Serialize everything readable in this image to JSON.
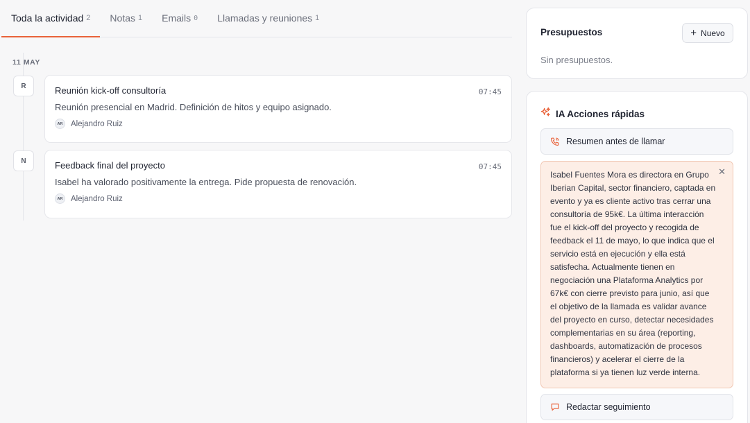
{
  "tabs": [
    {
      "label": "Toda la actividad",
      "count": "2"
    },
    {
      "label": "Notas",
      "count": "1"
    },
    {
      "label": "Emails",
      "count": "0"
    },
    {
      "label": "Llamadas y reuniones",
      "count": "1"
    }
  ],
  "timeline": {
    "date_label": "11 MAY",
    "items": [
      {
        "marker": "R",
        "title": "Reunión kick-off consultoría",
        "time": "07:45",
        "body": "Reunión presencial en Madrid. Definición de hitos y equipo asignado.",
        "author_initials": "AR",
        "author": "Alejandro Ruiz"
      },
      {
        "marker": "N",
        "title": "Feedback final del proyecto",
        "time": "07:45",
        "body": "Isabel ha valorado positivamente la entrega. Pide propuesta de renovación.",
        "author_initials": "AR",
        "author": "Alejandro Ruiz"
      }
    ]
  },
  "budgets": {
    "title": "Presupuestos",
    "new_label": "Nuevo",
    "empty_text": "Sin presupuestos."
  },
  "ai": {
    "title": "IA Acciones rápidas",
    "pre_call_label": "Resumen antes de llamar",
    "summary": "Isabel Fuentes Mora es directora en Grupo Iberian Capital, sector financiero, captada en evento y ya es cliente activo tras cerrar una consultoría de 95k€. La última interacción fue el kick-off del proyecto y recogida de feedback el 11 de mayo, lo que indica que el servicio está en ejecución y ella está satisfecha. Actualmente tienen en negociación una Plataforma Analytics por 67k€ con cierre previsto para junio, así que el objetivo de la llamada es validar avance del proyecto en curso, detectar necesidades complementarias en su área (reporting, dashboards, automatización de procesos financieros) y acelerar el cierre de la plataforma si ya tienen luz verde interna.",
    "follow_up_label": "Redactar seguimiento"
  },
  "colors": {
    "accent": "#e9623a",
    "summary_bg": "#fdeee6",
    "summary_border": "#f1c7b3"
  }
}
